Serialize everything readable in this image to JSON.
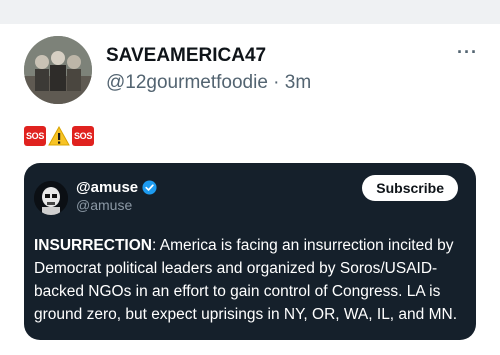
{
  "post": {
    "display_name": "SAVEAMERICA47",
    "handle": "@12gourmetfoodie",
    "separator": "·",
    "time": "3m",
    "more_label": "···",
    "emojis": [
      "SOS",
      "⚠",
      "SOS"
    ]
  },
  "quote": {
    "name": "@amuse",
    "handle": "@amuse",
    "subscribe_label": "Subscribe",
    "text_bold": "INSURRECTION",
    "text_body": ": America is facing an insurrection incited by Democrat political leaders and organized by Soros/USAID-backed NGOs in an effort to gain control of Congress. LA is ground zero, but expect uprisings in NY, OR, WA, IL, and MN."
  },
  "colors": {
    "card_bg": "#15202b",
    "verified": "#1d9bf0",
    "sos": "#e0221f",
    "secondary_text": "#536471"
  }
}
